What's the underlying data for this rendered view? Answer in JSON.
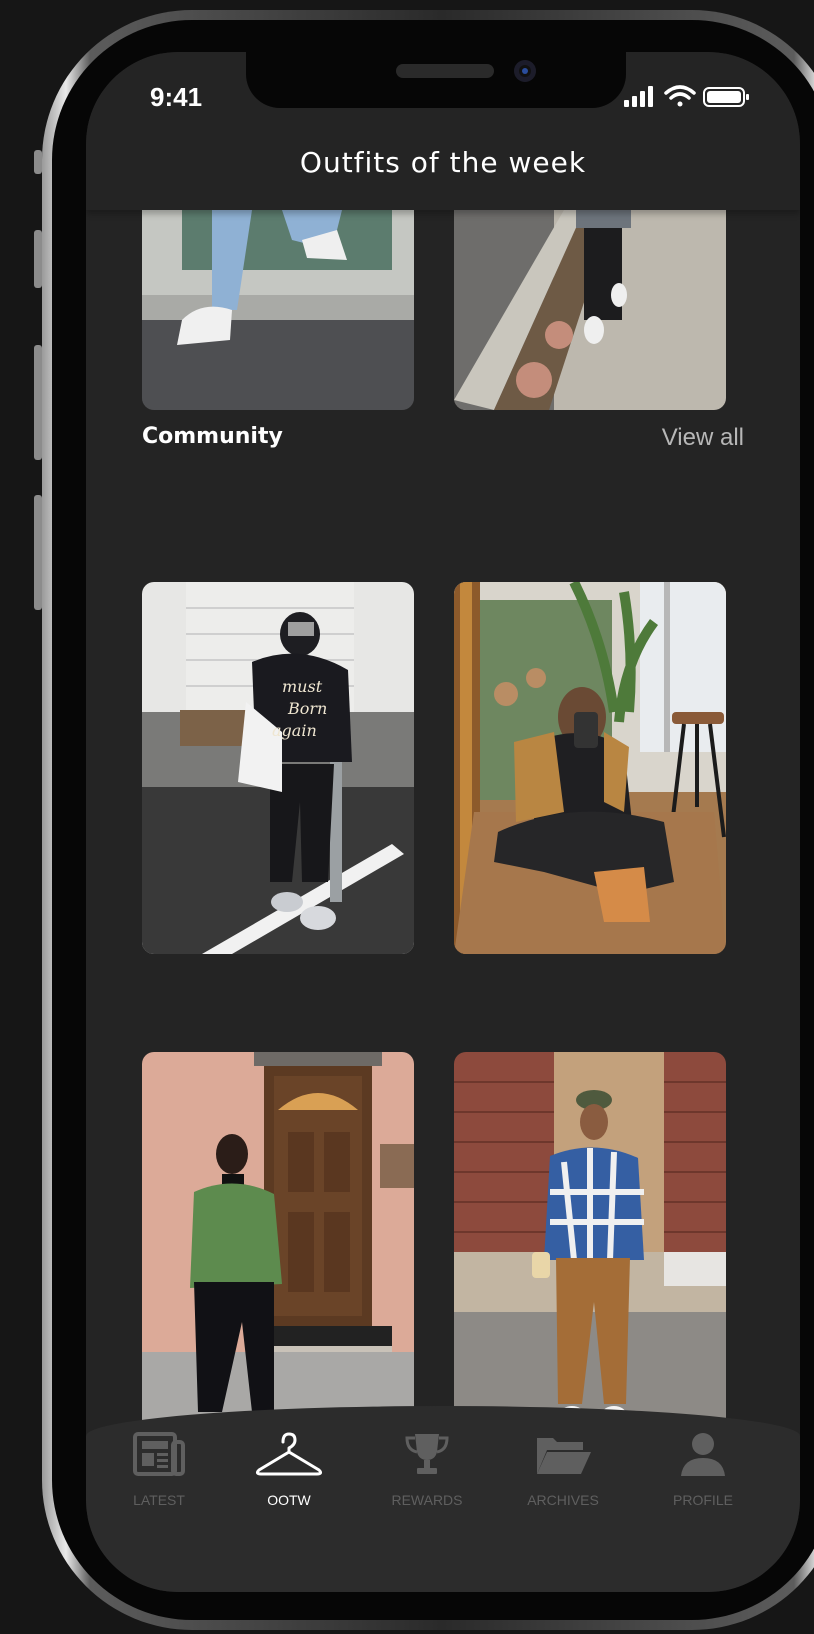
{
  "status_bar": {
    "time": "9:41",
    "signal_icon": "cellular-signal-icon",
    "wifi_icon": "wifi-icon",
    "battery_icon": "battery-icon"
  },
  "header": {
    "title": "Outfits of the week"
  },
  "community": {
    "title": "Community",
    "view_all": "View all"
  },
  "tab_bar": {
    "tabs": [
      {
        "label": "LATEST",
        "icon": "newspaper-icon",
        "active": false
      },
      {
        "label": "OOTW",
        "icon": "hanger-icon",
        "active": true
      },
      {
        "label": "REWARDS",
        "icon": "trophy-icon",
        "active": false
      },
      {
        "label": "ARCHIVES",
        "icon": "folder-icon",
        "active": false
      },
      {
        "label": "PROFILE",
        "icon": "user-icon",
        "active": false
      }
    ]
  },
  "colors": {
    "background": "#242424",
    "frame": "#060606",
    "text": "#ffffff",
    "muted": "#5f5f5f"
  }
}
